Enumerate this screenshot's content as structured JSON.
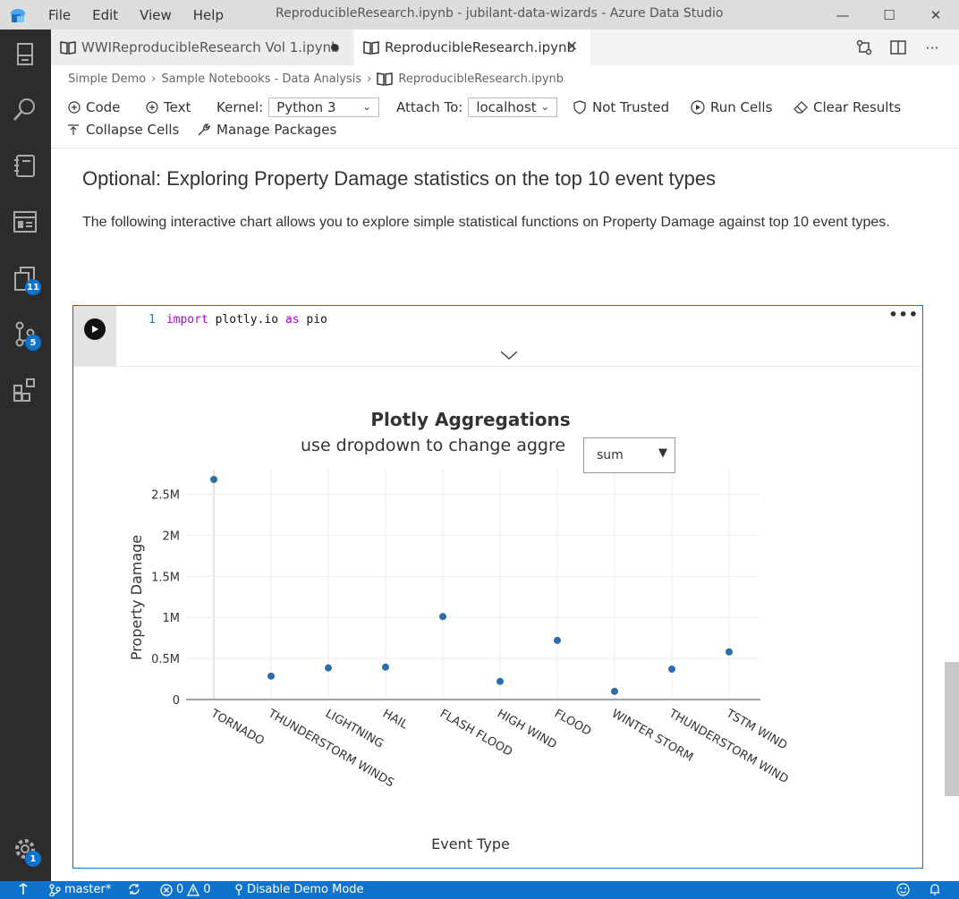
{
  "titlebar": {
    "menu": [
      "File",
      "Edit",
      "View",
      "Help"
    ],
    "title": "ReproducibleResearch.ipynb - jubilant-data-wizards - Azure Data Studio",
    "minimize": "—",
    "maximize": "☐",
    "close": "✕"
  },
  "activity": {
    "notebooks_badge": "11",
    "source_control_badge": "5",
    "settings_badge": "1"
  },
  "tabs": [
    {
      "label": "WWIReproducibleResearch Vol 1.ipynb",
      "dirty": true
    },
    {
      "label": "ReproducibleResearch.ipynb",
      "close": "✕"
    }
  ],
  "breadcrumb": [
    "Simple Demo",
    "Sample Notebooks - Data Analysis",
    "ReproducibleResearch.ipynb"
  ],
  "breadcrumb_sep": "›",
  "toolbar": {
    "code": "Code",
    "text": "Text",
    "kernel_label": "Kernel:",
    "kernel_value": "Python 3",
    "attach_label": "Attach To:",
    "attach_value": "localhost",
    "not_trusted": "Not Trusted",
    "run_cells": "Run Cells",
    "clear_results": "Clear Results",
    "collapse_cells": "Collapse Cells",
    "manage_packages": "Manage Packages"
  },
  "markdown": {
    "heading": "Optional: Exploring Property Damage statistics on the top 10 event types",
    "paragraph": "The following interactive chart allows you to explore simple statistical functions on Property Damage against top 10 event types."
  },
  "code_cell": {
    "line_number": "1",
    "kw_import": "import",
    "module": " plotly.io ",
    "kw_as": "as",
    "alias": " pio",
    "more": "•••"
  },
  "dropdown": {
    "selected": "sum",
    "arrow": "▼"
  },
  "chart_data": {
    "type": "scatter",
    "title": "Plotly Aggregations",
    "subtitle": "use dropdown to change aggre",
    "xlabel": "Event Type",
    "ylabel": "Property Damage",
    "categories": [
      "TORNADO",
      "THUNDERSTORM WINDS",
      "LIGHTNING",
      "HAIL",
      "FLASH FLOOD",
      "HIGH WIND",
      "FLOOD",
      "WINTER STORM",
      "THUNDERSTORM WIND",
      "TSTM WIND"
    ],
    "tick_labels": [
      "TORNADO",
      "THUNDERSTORM WINDS",
      "LIGHTNING",
      "HAIL",
      "FLASH FLOOD",
      "HIGH WIND",
      "FLOOD",
      "WINTER STORM",
      "THUNDERSTORM WIND",
      "TSTM WIND"
    ],
    "values": [
      2680000,
      285000,
      385000,
      395000,
      1010000,
      220000,
      720000,
      100000,
      370000,
      580000
    ],
    "yticks": [
      0,
      500000,
      1000000,
      1500000,
      2000000,
      2500000
    ],
    "ytick_labels": [
      "0",
      "0.5M",
      "1M",
      "1.5M",
      "2M",
      "2.5M"
    ],
    "ylim": [
      0,
      2800000
    ],
    "grid": true,
    "marker_color": "#2e6ea8"
  },
  "statusbar": {
    "branch": "master*",
    "errors": "0",
    "warnings": "0",
    "demo_mode": "Disable Demo Mode"
  },
  "colors": {
    "accent": "#0e73cc",
    "activity_bg": "#2c2c2c"
  }
}
